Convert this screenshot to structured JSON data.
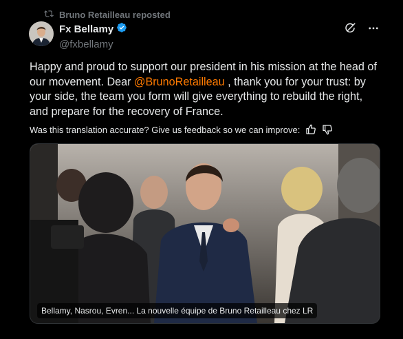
{
  "repost": {
    "text": "Bruno Retailleau reposted"
  },
  "author": {
    "name": "Fx Bellamy",
    "handle": "@fxbellamy",
    "verified": true
  },
  "post": {
    "text_before": "Happy and proud to support our president in his mission at the head of our movement. Dear ",
    "mention": "@BrunoRetailleau",
    "text_after": " , thank you for your trust: by your side, the team you form will give everything to rebuild the right, and prepare for the recovery of France."
  },
  "translation_feedback": {
    "text": "Was this translation accurate? Give us feedback so we can improve:"
  },
  "media": {
    "caption": "Bellamy, Nasrou, Evren... La nouvelle équipe de Bruno Retailleau chez LR"
  },
  "icons": {
    "repost": "repost-icon",
    "verified": "verified-badge-icon",
    "grok": "grok-icon",
    "more": "more-icon",
    "thumbs_up": "thumbs-up-icon",
    "thumbs_down": "thumbs-down-icon"
  },
  "colors": {
    "mention": "#ff7a00",
    "background": "#000000",
    "muted": "#71767b",
    "text": "#e7e9ea"
  }
}
